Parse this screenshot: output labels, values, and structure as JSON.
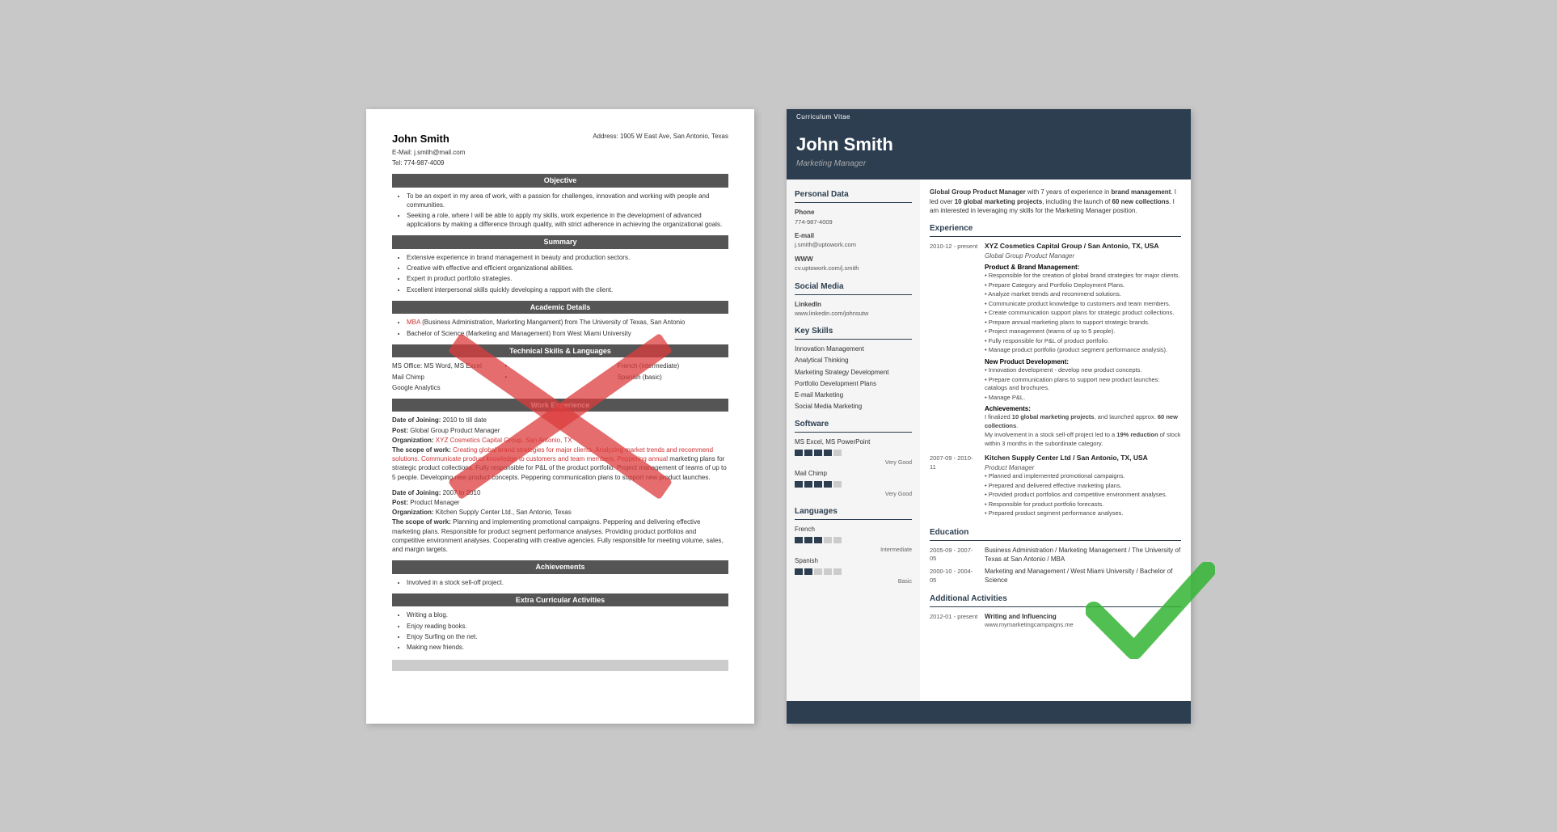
{
  "background_color": "#c8c8c8",
  "left_resume": {
    "name": "John Smith",
    "email": "E-Mail: j.smith@mail.com",
    "phone": "Tel: 774-987-4009",
    "address": "Address: 1905 W East Ave, San Antonio, Texas",
    "sections": {
      "objective": {
        "title": "Objective",
        "items": [
          "To be an expert in my area of work, with a passion for challenges, innovation and working with people and communities.",
          "Seeking a role, where I will be able to apply my skills, work experience in the development of advanced applications by making a difference through quality, with strict adherence in achieving the organizational goals."
        ]
      },
      "summary": {
        "title": "Summary",
        "items": [
          "Extensive experience in brand management in beauty and production sectors.",
          "Creative with effective and efficient organizational abilities.",
          "Expert in product portfolio strategies.",
          "Excellent interpersonal skills quickly developing a rapport with the client."
        ]
      },
      "academic": {
        "title": "Academic Details",
        "items": [
          "MBA (Business Administration, Marketing Mangament) from The University of Texas, San Antonio",
          "Bachelor of Science (Marketing and Management) from West Miami University"
        ],
        "red_word": "MBA"
      },
      "technical": {
        "title": "Technical Skills & Languages",
        "col1": [
          "MS Office: MS Word, MS Excel",
          "Mail Chimp",
          "Google Analytics"
        ],
        "col2": [
          "French (intermediate)",
          "Spanish (basic)"
        ]
      },
      "work": {
        "title": "Work Experience",
        "entry1": {
          "date_label": "Date of Joining:",
          "date": "2010 to till date",
          "post_label": "Post:",
          "post": "Global Group Product Manager",
          "org_label": "Organization:",
          "org": "XYZ Cosmetics Capital Group, San Antonio, TX",
          "scope_label": "The scope of work:",
          "scope": "Creating global brand strategies for major clients. Analyzing market trends and recommend solutions. Communicate product knowledge to customers and team members. Peppering annual marketing plans for strategic product collections. Fully responsible for P&L of the product portfolio. Project management of teams of up to 5 people. Developing new product concepts. Peppering communication plans to support new product launches."
        },
        "entry2": {
          "date_label": "Date of Joining:",
          "date": "2007 to 2010",
          "post_label": "Post:",
          "post": "Product Manager",
          "org_label": "Organization:",
          "org": "Kitchen Supply Center Ltd., San Antonio, Texas",
          "scope_label": "The scope of work:",
          "scope": "Planning and implementing promotional campaigns. Peppering and delivering effective marketing plans. Responsible for product segment performance analyses. Providing product portfolios and competitive environment analyses. Cooperating with creative agencies. Fully responsible for meeting volume, sales, and margin targets."
        }
      },
      "achievements": {
        "title": "Achievements",
        "items": [
          "Involved in a stock sell-off project."
        ]
      },
      "extra": {
        "title": "Extra Curricular Activities",
        "items": [
          "Writing a blog.",
          "Enjoy reading books.",
          "Enjoy Surfing on the net.",
          "Making new friends."
        ]
      }
    }
  },
  "right_resume": {
    "cv_label": "Curriculum Vitae",
    "name": "John Smith",
    "title": "Marketing Manager",
    "sidebar": {
      "personal_data_title": "Personal Data",
      "phone_label": "Phone",
      "phone": "774-987-4009",
      "email_label": "E-mail",
      "email": "j.smith@uptowork.com",
      "www_label": "WWW",
      "www": "cv.uptowork.com/j.smith",
      "social_media_title": "Social Media",
      "linkedin_label": "LinkedIn",
      "linkedin": "www.linkedin.com/johnsutw",
      "key_skills_title": "Key Skills",
      "skills": [
        "Innovation Management",
        "Analytical Thinking",
        "Marketing Strategy Development",
        "Portfolio Development Plans",
        "E-mail Marketing",
        "Social Media Marketing"
      ],
      "software_title": "Software",
      "software": [
        {
          "name": "MS Excel, MS PowerPoint",
          "level": 4,
          "label": "Very Good"
        },
        {
          "name": "Mail Chimp",
          "level": 4,
          "label": "Very Good"
        }
      ],
      "languages_title": "Languages",
      "languages": [
        {
          "name": "French",
          "level": 3,
          "label": "Intermediate"
        },
        {
          "name": "Spanish",
          "level": 2,
          "label": "Basic"
        }
      ]
    },
    "main": {
      "summary": "Global Group Product Manager with 7 years of experience in brand management. I led over 10 global marketing projects, including the launch of 60 new collections. I am interested in leveraging my skills for the Marketing Manager position.",
      "experience_title": "Experience",
      "experience": [
        {
          "dates": "2010-12 - present",
          "company": "XYZ Cosmetics Capital Group / San Antonio, TX, USA",
          "position": "Global Group Product Manager",
          "sections": [
            {
              "subtitle": "Product & Brand Management:",
              "bullets": [
                "Responsible for the creation of global brand strategies for major clients.",
                "Prepare Category and Portfolio Deployment Plans.",
                "Analyze market trends and recommend solutions.",
                "Communicate product knowledge to customers and team members.",
                "Create communication support plans for strategic product collections.",
                "Prepare annual marketing plans to support strategic brands.",
                "Project management (teams of up to 5 people).",
                "Fully responsible for P&L of product portfolio.",
                "Manage product portfolio (product segment performance analysis)."
              ]
            },
            {
              "subtitle": "New Product Development:",
              "bullets": [
                "Innovation development - develop new product concepts.",
                "Prepare communication plans to support new product launches: catalogs and brochures.",
                "Manage P&L."
              ]
            },
            {
              "subtitle": "Achievements:",
              "achievement_text": "I finalized 10 global marketing projects, and launched approx. 60 new collections.",
              "achievement_text2": "My involvement in a stock sell-off project led to a 19% reduction of stock within 3 months in the subordinate category."
            }
          ]
        },
        {
          "dates": "2007-09 - 2010-11",
          "company": "Kitchen Supply Center Ltd / San Antonio, TX, USA",
          "position": "Product Manager",
          "bullets": [
            "Planned and implemented promotional campaigns.",
            "Prepared and delivered effective marketing plans.",
            "Provided product portfolios and competitive environment analyses.",
            "Responsible for product portfolio forecasts.",
            "Prepared product segment performance analyses."
          ]
        }
      ],
      "education_title": "Education",
      "education": [
        {
          "dates": "2005-09 - 2007-05",
          "degree": "Business Administration / Marketing Management / The University of Texas at San Antonio / MBA"
        },
        {
          "dates": "2000-10 - 2004-05",
          "degree": "Marketing and Management / West Miami University / Bachelor of Science"
        }
      ],
      "activities_title": "Additional Activities",
      "activities": [
        {
          "dates": "2012-01 - present",
          "title": "Writing and Influencing",
          "url": "www.mymarketingcampaigns.me"
        }
      ]
    }
  }
}
